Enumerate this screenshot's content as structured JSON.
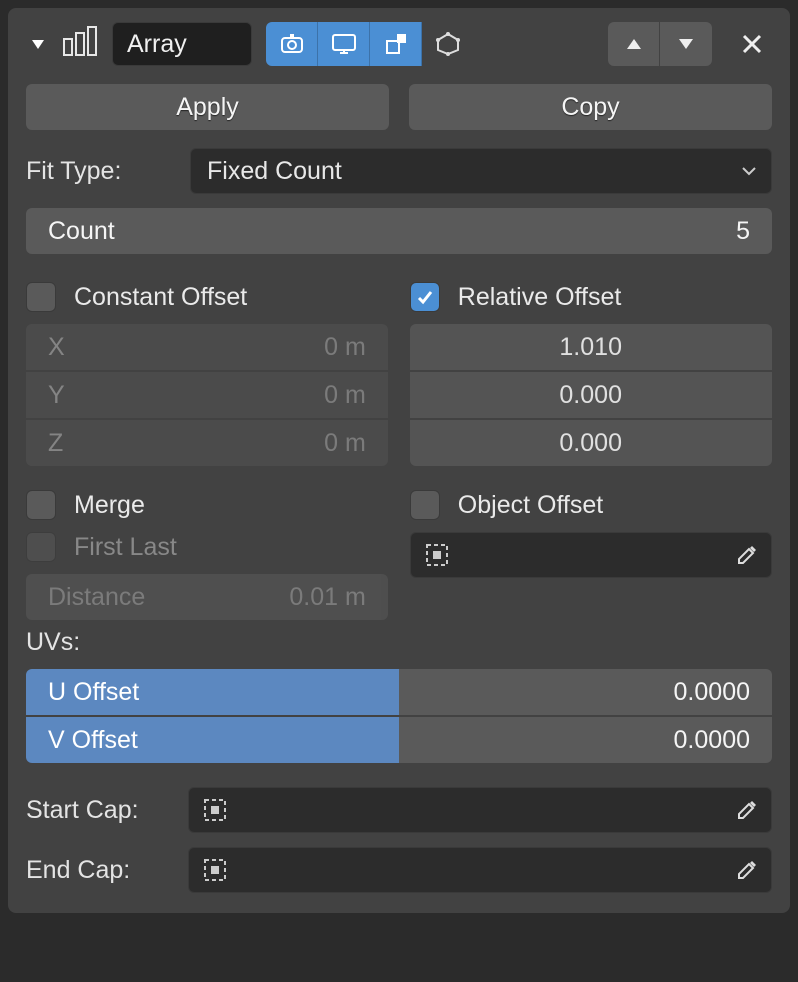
{
  "modifier": {
    "name": "Array",
    "apply_label": "Apply",
    "copy_label": "Copy"
  },
  "fit": {
    "label": "Fit Type:",
    "value": "Fixed Count",
    "count_label": "Count",
    "count_value": "5"
  },
  "constant_offset": {
    "label": "Constant Offset",
    "checked": false,
    "x_label": "X",
    "x_value": "0 m",
    "y_label": "Y",
    "y_value": "0 m",
    "z_label": "Z",
    "z_value": "0 m"
  },
  "relative_offset": {
    "label": "Relative Offset",
    "checked": true,
    "x_value": "1.010",
    "y_value": "0.000",
    "z_value": "0.000"
  },
  "merge": {
    "label": "Merge",
    "checked": false,
    "first_last_label": "First Last",
    "distance_label": "Distance",
    "distance_value": "0.01 m"
  },
  "object_offset": {
    "label": "Object Offset",
    "checked": false
  },
  "uvs": {
    "label": "UVs:",
    "u_label": "U Offset",
    "u_value": "0.0000",
    "v_label": "V Offset",
    "v_value": "0.0000"
  },
  "caps": {
    "start_label": "Start Cap:",
    "end_label": "End Cap:"
  }
}
